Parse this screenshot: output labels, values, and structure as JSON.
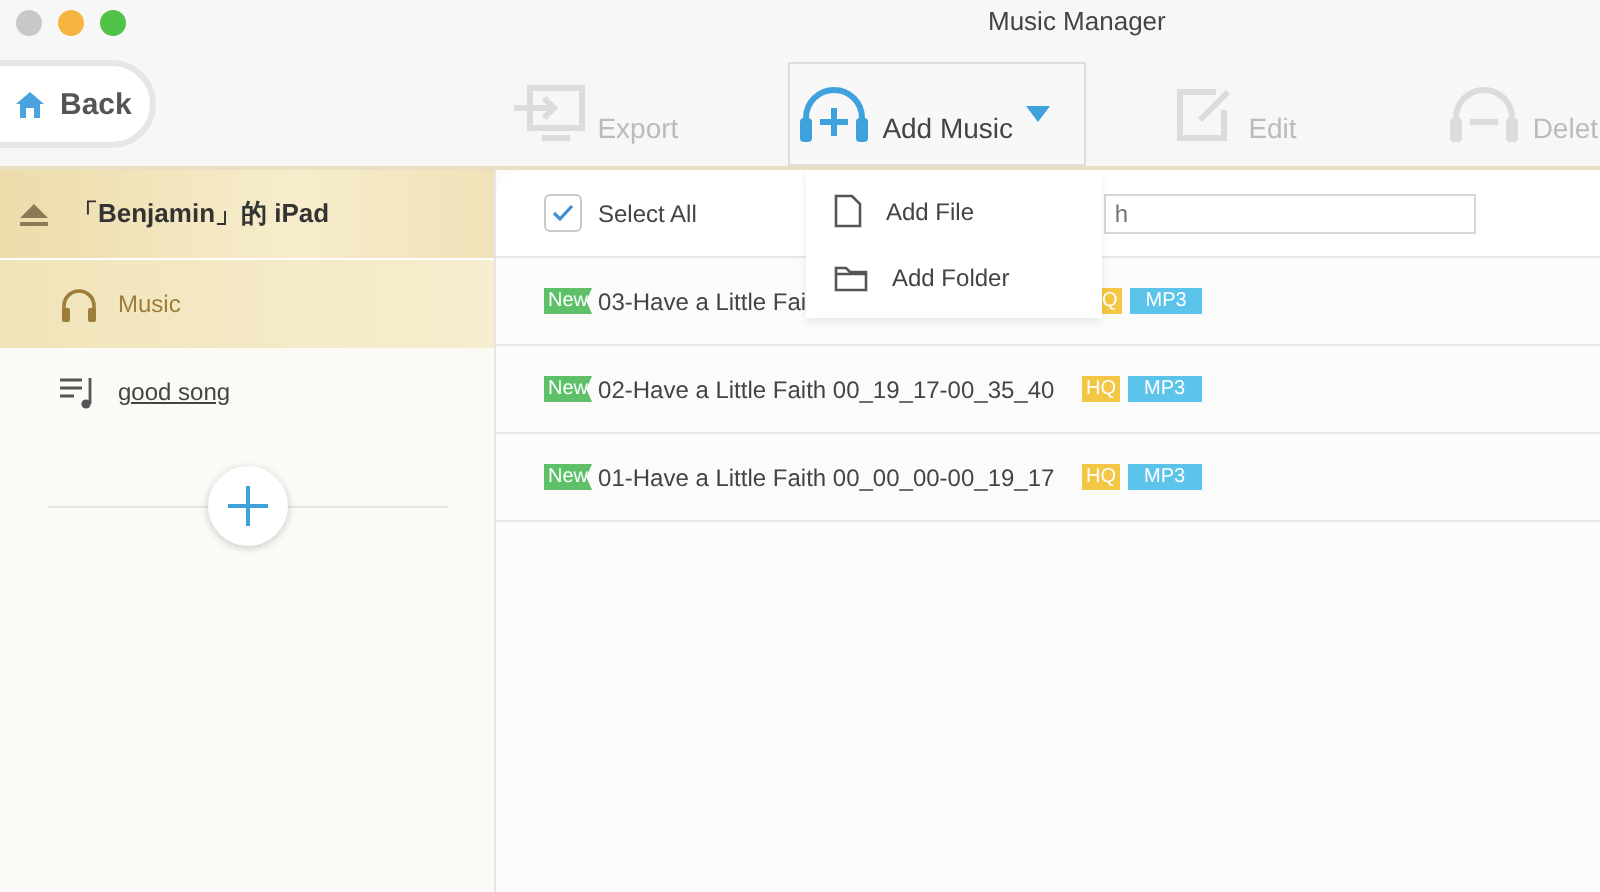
{
  "window": {
    "title": "Music Manager"
  },
  "toolbar": {
    "back": "Back",
    "actions": [
      {
        "kind": "export",
        "label": "Export",
        "disabled": true
      },
      {
        "kind": "add",
        "label": "Add Music",
        "disabled": false
      },
      {
        "kind": "edit",
        "label": "Edit",
        "disabled": true
      },
      {
        "kind": "delete",
        "label": "Delet",
        "disabled": true
      }
    ]
  },
  "add_menu": {
    "expanded": true,
    "items": [
      {
        "kind": "file",
        "label": "Add File"
      },
      {
        "kind": "folder",
        "label": "Add Folder"
      }
    ]
  },
  "sidebar": {
    "device": "「Benjamin」的 iPad",
    "items": [
      {
        "kind": "music",
        "label": "Music",
        "selected": true
      },
      {
        "kind": "playlist",
        "label": "good song",
        "selected": false
      }
    ]
  },
  "list": {
    "select_all": {
      "label": "Select All",
      "checked": true
    },
    "search": {
      "placeholder": "h"
    },
    "rows": [
      {
        "badge": "New",
        "title": "03-Have a Little Fai",
        "hq": "Q",
        "format": "MP3"
      },
      {
        "badge": "New",
        "title": "02-Have a Little Faith 00_19_17-00_35_40",
        "hq": "HQ",
        "format": "MP3"
      },
      {
        "badge": "New",
        "title": "01-Have a Little Faith 00_00_00-00_19_17",
        "hq": "HQ",
        "format": "MP3"
      }
    ]
  }
}
